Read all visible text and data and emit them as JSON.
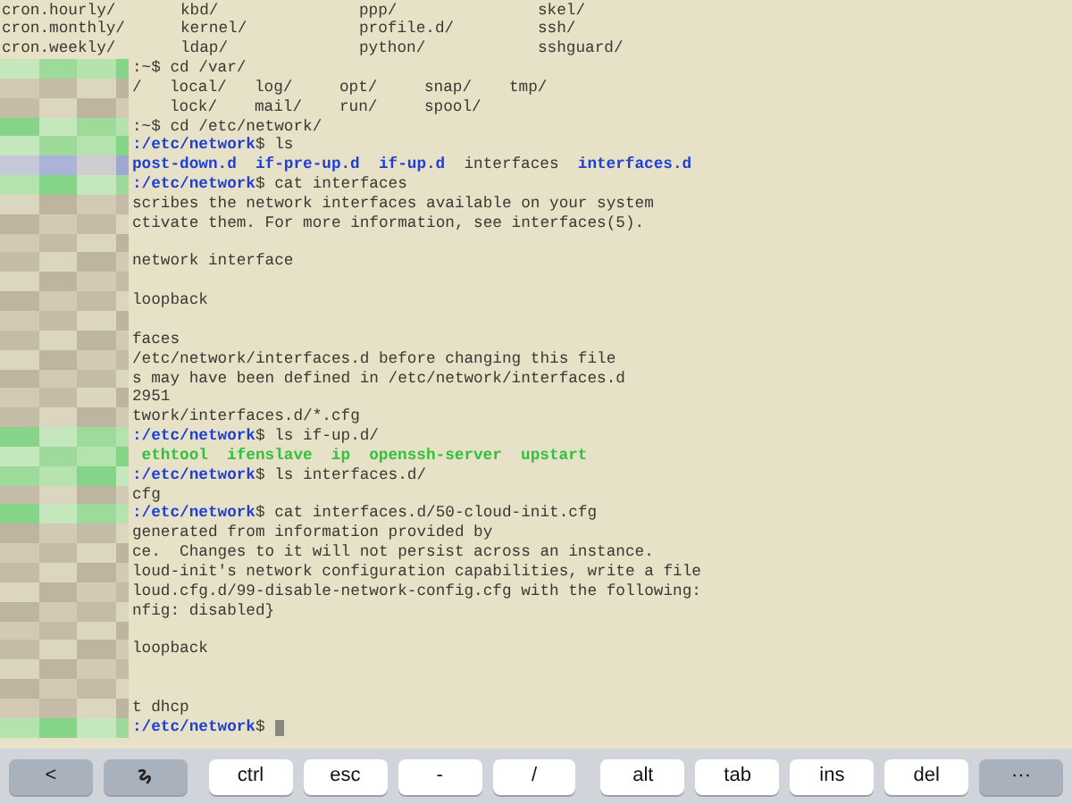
{
  "terminal": {
    "lines": [
      {
        "kind": "columns",
        "segments": [
          {
            "text": "cron.hourly/",
            "kind": "plain"
          },
          {
            "text": "kbd/",
            "kind": "plain"
          },
          {
            "text": "ppp/",
            "kind": "plain"
          },
          {
            "text": "skel/",
            "kind": "plain"
          }
        ]
      },
      {
        "kind": "columns",
        "segments": [
          {
            "text": "cron.monthly/",
            "kind": "plain"
          },
          {
            "text": "kernel/",
            "kind": "plain"
          },
          {
            "text": "profile.d/",
            "kind": "plain"
          },
          {
            "text": "ssh/",
            "kind": "plain"
          }
        ]
      },
      {
        "kind": "columns",
        "segments": [
          {
            "text": "cron.weekly/",
            "kind": "plain"
          },
          {
            "text": "ldap/",
            "kind": "plain"
          },
          {
            "text": "python/",
            "kind": "plain"
          },
          {
            "text": "sshguard/",
            "kind": "plain"
          }
        ]
      },
      {
        "kind": "prompt",
        "segments": [
          {
            "text": ":~$ cd /var/",
            "kind": "plain"
          }
        ]
      },
      {
        "kind": "varcols",
        "segments": [
          {
            "text": "/",
            "kind": "plain"
          },
          {
            "text": "local/",
            "kind": "plain"
          },
          {
            "text": "log/",
            "kind": "plain"
          },
          {
            "text": "opt/",
            "kind": "plain"
          },
          {
            "text": "snap/",
            "kind": "plain"
          },
          {
            "text": "tmp/",
            "kind": "plain"
          }
        ]
      },
      {
        "kind": "varindent",
        "segments": [
          {
            "text": "lock/",
            "kind": "plain"
          },
          {
            "text": "mail/",
            "kind": "plain"
          },
          {
            "text": "run/",
            "kind": "plain"
          },
          {
            "text": "spool/",
            "kind": "plain"
          }
        ]
      },
      {
        "kind": "prompt",
        "segments": [
          {
            "text": ":~$ cd /etc/network/",
            "kind": "plain"
          }
        ]
      },
      {
        "kind": "prompt",
        "segments": [
          {
            "text": ":/etc/network",
            "kind": "path"
          },
          {
            "text": "$ ls",
            "kind": "plain"
          }
        ]
      },
      {
        "kind": "dirlist",
        "segments": [
          {
            "text": "post-down.d",
            "kind": "dir"
          },
          {
            "text": "if-pre-up.d",
            "kind": "dir"
          },
          {
            "text": "if-up.d",
            "kind": "dir"
          },
          {
            "text": "interfaces",
            "kind": "plain"
          },
          {
            "text": "interfaces.d",
            "kind": "dir"
          }
        ]
      },
      {
        "kind": "prompt",
        "segments": [
          {
            "text": ":/etc/network",
            "kind": "path"
          },
          {
            "text": "$ cat interfaces",
            "kind": "plain"
          }
        ]
      },
      {
        "kind": "output",
        "segments": [
          {
            "text": "scribes the network interfaces available on your system",
            "kind": "plain"
          }
        ]
      },
      {
        "kind": "output",
        "segments": [
          {
            "text": "ctivate them. For more information, see interfaces(5).",
            "kind": "plain"
          }
        ]
      },
      {
        "kind": "output"
      },
      {
        "kind": "output",
        "segments": [
          {
            "text": "network interface",
            "kind": "plain"
          }
        ]
      },
      {
        "kind": "output"
      },
      {
        "kind": "output",
        "segments": [
          {
            "text": "loopback",
            "kind": "plain"
          }
        ]
      },
      {
        "kind": "output"
      },
      {
        "kind": "output",
        "segments": [
          {
            "text": "faces",
            "kind": "plain"
          }
        ]
      },
      {
        "kind": "output",
        "segments": [
          {
            "text": "/etc/network/interfaces.d before changing this file",
            "kind": "plain"
          }
        ]
      },
      {
        "kind": "output",
        "segments": [
          {
            "text": "s may have been defined in /etc/network/interfaces.d",
            "kind": "plain"
          }
        ]
      },
      {
        "kind": "output",
        "segments": [
          {
            "text": "2951",
            "kind": "plain"
          }
        ]
      },
      {
        "kind": "output",
        "segments": [
          {
            "text": "twork/interfaces.d/*.cfg",
            "kind": "plain"
          }
        ]
      },
      {
        "kind": "prompt",
        "segments": [
          {
            "text": ":/etc/network",
            "kind": "path"
          },
          {
            "text": "$ ls if-up.d/",
            "kind": "plain"
          }
        ]
      },
      {
        "kind": "execlist",
        "segments": [
          {
            "text": "ethtool",
            "kind": "exec"
          },
          {
            "text": "ifenslave",
            "kind": "exec"
          },
          {
            "text": "ip",
            "kind": "exec"
          },
          {
            "text": "openssh-server",
            "kind": "exec"
          },
          {
            "text": "upstart",
            "kind": "exec"
          }
        ]
      },
      {
        "kind": "prompt",
        "segments": [
          {
            "text": ":/etc/network",
            "kind": "path"
          },
          {
            "text": "$ ls interfaces.d/",
            "kind": "plain"
          }
        ]
      },
      {
        "kind": "output",
        "segments": [
          {
            "text": "cfg",
            "kind": "plain"
          }
        ]
      },
      {
        "kind": "prompt",
        "segments": [
          {
            "text": ":/etc/network",
            "kind": "path"
          },
          {
            "text": "$ cat interfaces.d/50-cloud-init.cfg",
            "kind": "plain"
          }
        ]
      },
      {
        "kind": "output",
        "segments": [
          {
            "text": "generated from information provided by",
            "kind": "plain"
          }
        ]
      },
      {
        "kind": "output",
        "segments": [
          {
            "text": "ce.  Changes to it will not persist across an instance.",
            "kind": "plain"
          }
        ]
      },
      {
        "kind": "output",
        "segments": [
          {
            "text": "loud-init's network configuration capabilities, write a file",
            "kind": "plain"
          }
        ]
      },
      {
        "kind": "output",
        "segments": [
          {
            "text": "loud.cfg.d/99-disable-network-config.cfg with the following:",
            "kind": "plain"
          }
        ]
      },
      {
        "kind": "output",
        "segments": [
          {
            "text": "nfig: disabled}",
            "kind": "plain"
          }
        ]
      },
      {
        "kind": "output"
      },
      {
        "kind": "output",
        "segments": [
          {
            "text": "loopback",
            "kind": "plain"
          }
        ]
      },
      {
        "kind": "output"
      },
      {
        "kind": "output"
      },
      {
        "kind": "output",
        "segments": [
          {
            "text": "t dhcp",
            "kind": "plain"
          }
        ]
      },
      {
        "kind": "prompt",
        "cursor": true,
        "segments": [
          {
            "text": ":/etc/network",
            "kind": "path"
          },
          {
            "text": "$",
            "kind": "plain"
          }
        ]
      }
    ]
  },
  "keys": [
    {
      "kind": "dark",
      "label": "<"
    },
    {
      "kind": "dark"
    },
    {
      "kind": "light",
      "label": "ctrl"
    },
    {
      "kind": "light",
      "label": "esc"
    },
    {
      "kind": "light",
      "label": "-"
    },
    {
      "kind": "light",
      "label": "/"
    },
    {
      "kind": "light",
      "label": "alt"
    },
    {
      "kind": "light",
      "label": "tab"
    },
    {
      "kind": "light",
      "label": "ins"
    },
    {
      "kind": "light",
      "label": "del"
    },
    {
      "kind": "dark",
      "label": "···"
    }
  ]
}
